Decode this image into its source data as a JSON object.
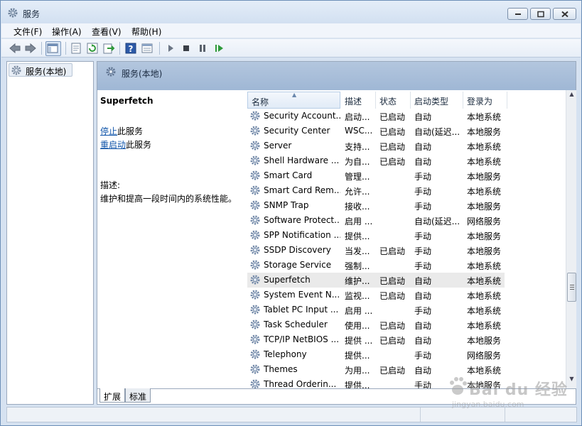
{
  "window": {
    "title": "服务"
  },
  "menu": [
    {
      "label": "文件(F)"
    },
    {
      "label": "操作(A)"
    },
    {
      "label": "查看(V)"
    },
    {
      "label": "帮助(H)"
    }
  ],
  "tree": {
    "root_label": "服务(本地)"
  },
  "pane": {
    "header_label": "服务(本地)",
    "selected_service": "Superfetch",
    "stop_link": "停止",
    "stop_suffix": "此服务",
    "restart_link": "重启动",
    "restart_suffix": "此服务",
    "desc_label": "描述:",
    "desc_text": "维护和提高一段时间内的系统性能。"
  },
  "columns": {
    "name": "名称",
    "desc": "描述",
    "status": "状态",
    "startup": "启动类型",
    "logon": "登录为"
  },
  "services": [
    {
      "name": "Security Account...",
      "desc": "启动...",
      "status": "已启动",
      "startup": "自动",
      "logon": "本地系统"
    },
    {
      "name": "Security Center",
      "desc": "WSC...",
      "status": "已启动",
      "startup": "自动(延迟...",
      "logon": "本地服务"
    },
    {
      "name": "Server",
      "desc": "支持...",
      "status": "已启动",
      "startup": "自动",
      "logon": "本地系统"
    },
    {
      "name": "Shell Hardware ...",
      "desc": "为自...",
      "status": "已启动",
      "startup": "自动",
      "logon": "本地系统"
    },
    {
      "name": "Smart Card",
      "desc": "管理...",
      "status": "",
      "startup": "手动",
      "logon": "本地服务"
    },
    {
      "name": "Smart Card Rem...",
      "desc": "允许...",
      "status": "",
      "startup": "手动",
      "logon": "本地系统"
    },
    {
      "name": "SNMP Trap",
      "desc": "接收...",
      "status": "",
      "startup": "手动",
      "logon": "本地服务"
    },
    {
      "name": "Software Protect...",
      "desc": "启用 ...",
      "status": "",
      "startup": "自动(延迟...",
      "logon": "网络服务"
    },
    {
      "name": "SPP Notification ...",
      "desc": "提供...",
      "status": "",
      "startup": "手动",
      "logon": "本地服务"
    },
    {
      "name": "SSDP Discovery",
      "desc": "当发...",
      "status": "已启动",
      "startup": "手动",
      "logon": "本地服务"
    },
    {
      "name": "Storage Service",
      "desc": "强制...",
      "status": "",
      "startup": "手动",
      "logon": "本地系统"
    },
    {
      "name": "Superfetch",
      "desc": "维护...",
      "status": "已启动",
      "startup": "自动",
      "logon": "本地系统"
    },
    {
      "name": "System Event N...",
      "desc": "监视...",
      "status": "已启动",
      "startup": "自动",
      "logon": "本地系统"
    },
    {
      "name": "Tablet PC Input ...",
      "desc": "启用 ...",
      "status": "",
      "startup": "手动",
      "logon": "本地系统"
    },
    {
      "name": "Task Scheduler",
      "desc": "使用...",
      "status": "已启动",
      "startup": "自动",
      "logon": "本地系统"
    },
    {
      "name": "TCP/IP NetBIOS ...",
      "desc": "提供 ...",
      "status": "已启动",
      "startup": "自动",
      "logon": "本地服务"
    },
    {
      "name": "Telephony",
      "desc": "提供...",
      "status": "",
      "startup": "手动",
      "logon": "网络服务"
    },
    {
      "name": "Themes",
      "desc": "为用...",
      "status": "已启动",
      "startup": "自动",
      "logon": "本地系统"
    },
    {
      "name": "Thread Orderin...",
      "desc": "提供...",
      "status": "",
      "startup": "手动",
      "logon": "本地服务"
    }
  ],
  "selected_index": 11,
  "tabs": [
    {
      "label": "扩展"
    },
    {
      "label": "标准"
    }
  ],
  "watermark": {
    "main": "Bai du 经验",
    "sub": "jingyan.baidu.com"
  },
  "icons": {
    "title": "gear-icon",
    "service": "gear-icon",
    "toolbar": [
      "back-icon",
      "forward-icon",
      "console-tree-icon",
      "properties-icon",
      "refresh-icon",
      "export-icon",
      "help-icon",
      "view-icon",
      "play-icon",
      "stop-icon",
      "pause-icon",
      "resume-icon"
    ]
  },
  "colors": {
    "link": "#1155aa",
    "header": "#a9bfdb",
    "selected_row": "#eaeaea"
  }
}
